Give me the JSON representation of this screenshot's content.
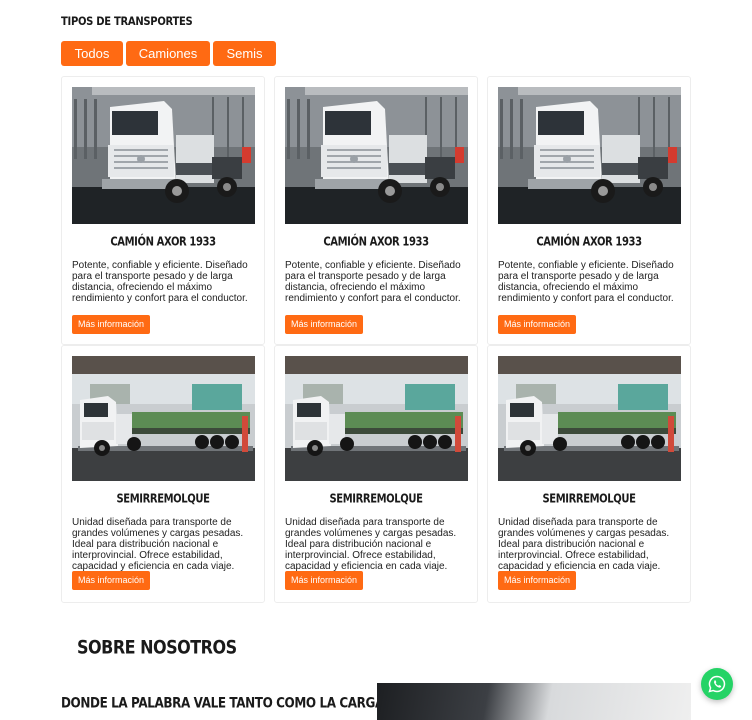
{
  "section": {
    "title": "TIPOS DE TRANSPORTES"
  },
  "filters": [
    {
      "label": "Todos"
    },
    {
      "label": "Camiones"
    },
    {
      "label": "Semis"
    }
  ],
  "cards": [
    {
      "image": "tractor-truck-photo",
      "title": "CAMIÓN AXOR 1933",
      "description": "Potente, confiable y eficiente. Diseñado para el transporte pesado y de larga distancia, ofreciendo el máximo rendimiento y confort para el conductor.",
      "button": "Más información"
    },
    {
      "image": "tractor-truck-photo",
      "title": "CAMIÓN AXOR 1933",
      "description": "Potente, confiable y eficiente. Diseñado para el transporte pesado y de larga distancia, ofreciendo el máximo rendimiento y confort para el conductor.",
      "button": "Más información"
    },
    {
      "image": "tractor-truck-photo",
      "title": "CAMIÓN AXOR 1933",
      "description": "Potente, confiable y eficiente. Diseñado para el transporte pesado y de larga distancia, ofreciendo el máximo rendimiento y confort para el conductor.",
      "button": "Más información"
    },
    {
      "image": "semitrailer-truck-photo",
      "title": "SEMIRREMOLQUE",
      "description": "Unidad diseñada para transporte de grandes volúmenes y cargas pesadas. Ideal para distribución nacional e interprovincial. Ofrece estabilidad, capacidad y eficiencia en cada viaje.",
      "button": "Más información"
    },
    {
      "image": "semitrailer-truck-photo",
      "title": "SEMIRREMOLQUE",
      "description": "Unidad diseñada para transporte de grandes volúmenes y cargas pesadas. Ideal para distribución nacional e interprovincial. Ofrece estabilidad, capacidad y eficiencia en cada viaje.",
      "button": "Más información"
    },
    {
      "image": "semitrailer-truck-photo",
      "title": "SEMIRREMOLQUE",
      "description": "Unidad diseñada para transporte de grandes volúmenes y cargas pesadas. Ideal para distribución nacional e interprovincial. Ofrece estabilidad, capacidad y eficiencia en cada viaje.",
      "button": "Más información"
    }
  ],
  "about": {
    "title": "SOBRE NOSOTROS",
    "subtitle": "DONDE LA PALABRA VALE TANTO COMO LA CARGA"
  },
  "floating": {
    "icon": "whatsapp-icon"
  },
  "colors": {
    "accent": "#ff6a13",
    "whatsapp": "#25d366"
  }
}
